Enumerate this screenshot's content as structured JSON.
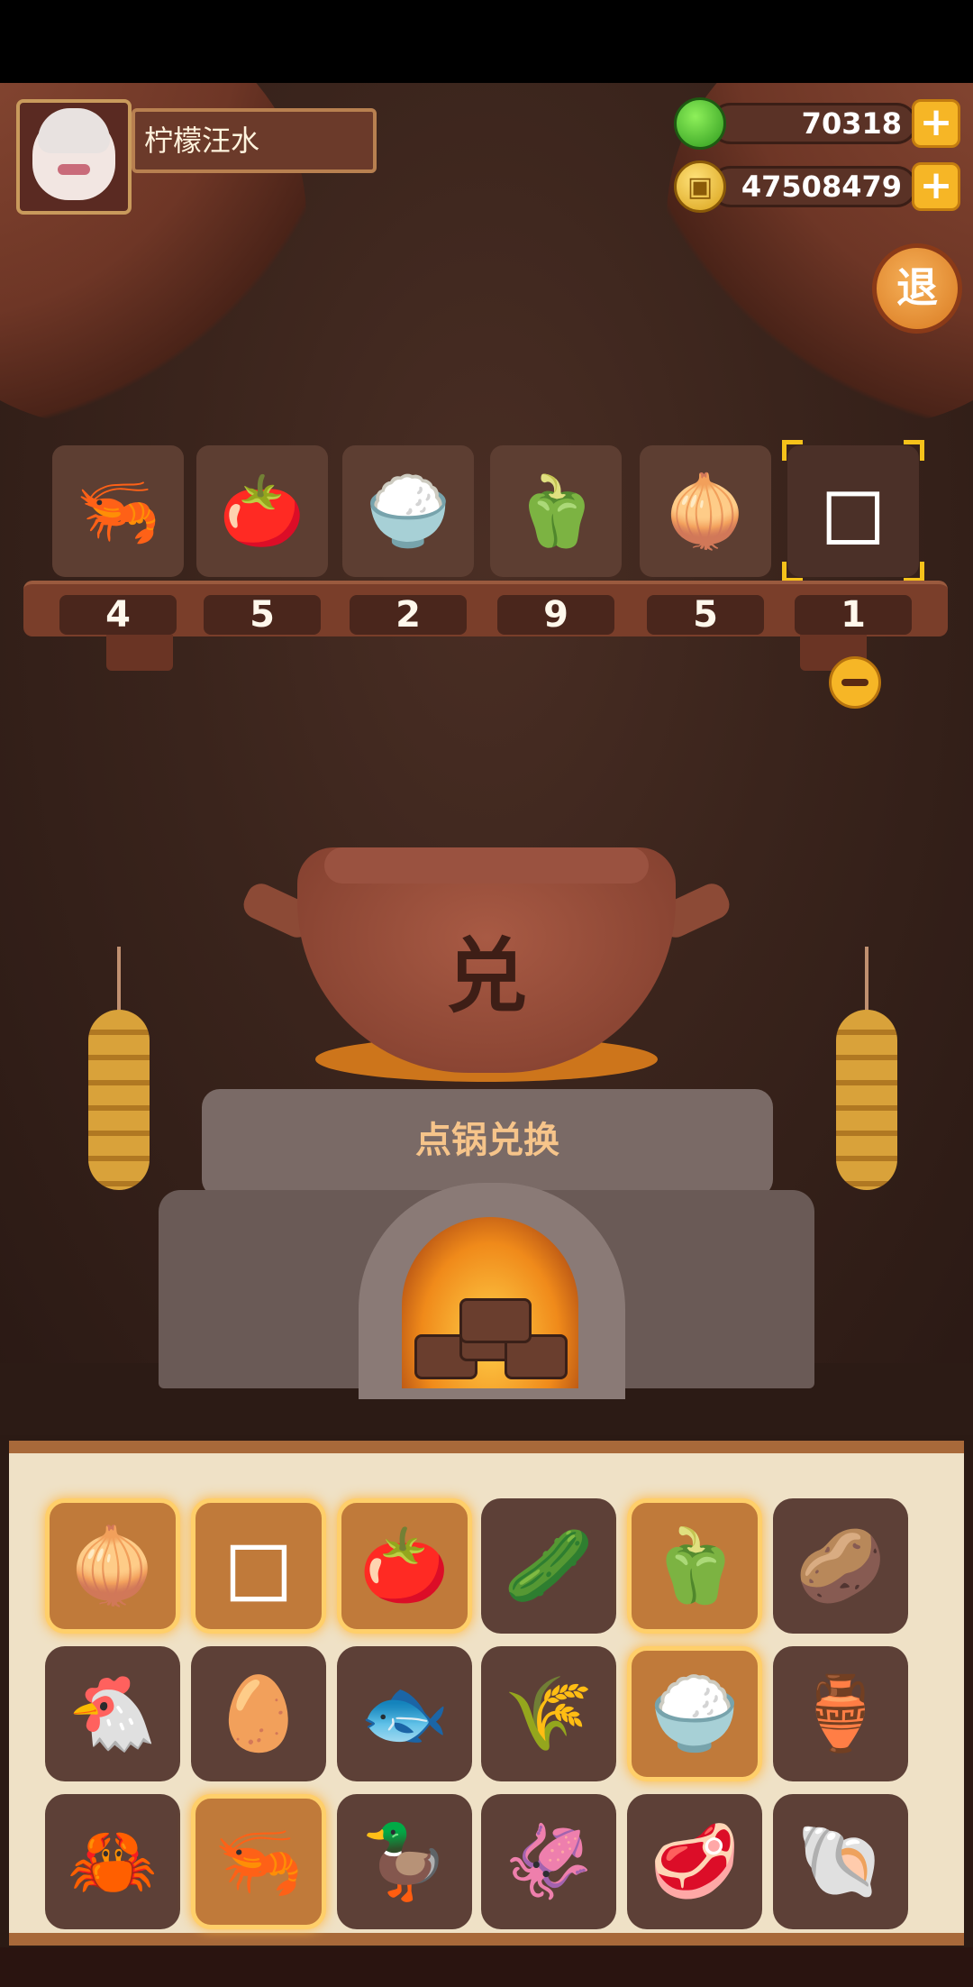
{
  "user": {
    "name": "柠檬汪水"
  },
  "resources": {
    "gems": "70318",
    "coins": "47508479",
    "add_label": "+"
  },
  "exit_button": {
    "label": "退"
  },
  "selected_ingredients": [
    {
      "icon": "🦐",
      "name": "shrimp",
      "count": "4"
    },
    {
      "icon": "🍅",
      "name": "tomato",
      "count": "5"
    },
    {
      "icon": "🍚",
      "name": "rice-bowl",
      "count": "2"
    },
    {
      "icon": "🫑",
      "name": "green-pepper",
      "count": "9"
    },
    {
      "icon": "🧅",
      "name": "scallion",
      "count": "5"
    },
    {
      "icon": "◻",
      "name": "tofu",
      "count": "1"
    }
  ],
  "pot": {
    "character": "兑",
    "action_label": "点锅兑换"
  },
  "inventory": [
    {
      "icon": "🧅",
      "name": "scallion",
      "highlighted": true
    },
    {
      "icon": "◻",
      "name": "tofu",
      "highlighted": true
    },
    {
      "icon": "🍅",
      "name": "tomato",
      "highlighted": true
    },
    {
      "icon": "🥒",
      "name": "cucumber",
      "highlighted": false
    },
    {
      "icon": "🫑",
      "name": "green-pepper",
      "highlighted": true
    },
    {
      "icon": "🥔",
      "name": "potato",
      "highlighted": false
    },
    {
      "icon": "🐔",
      "name": "chicken",
      "highlighted": false
    },
    {
      "icon": "🥚",
      "name": "egg",
      "highlighted": false
    },
    {
      "icon": "🐟",
      "name": "fish",
      "highlighted": false
    },
    {
      "icon": "🌾",
      "name": "flour-sack",
      "highlighted": false
    },
    {
      "icon": "🍚",
      "name": "rice-bowl",
      "highlighted": true
    },
    {
      "icon": "🏺",
      "name": "jar",
      "highlighted": false
    },
    {
      "icon": "🦀",
      "name": "crab",
      "highlighted": false
    },
    {
      "icon": "🦐",
      "name": "shrimp",
      "highlighted": true
    },
    {
      "icon": "🦆",
      "name": "duck",
      "highlighted": false
    },
    {
      "icon": "🦑",
      "name": "squid",
      "highlighted": false
    },
    {
      "icon": "🥩",
      "name": "meat",
      "highlighted": false
    },
    {
      "icon": "🐚",
      "name": "clam",
      "highlighted": false
    }
  ]
}
